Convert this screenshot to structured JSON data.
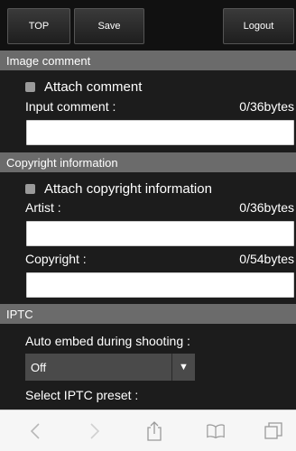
{
  "toolbar": {
    "top_label": "TOP",
    "save_label": "Save",
    "logout_label": "Logout"
  },
  "image_comment": {
    "header": "Image comment",
    "attach_label": "Attach comment",
    "input_label": "Input comment :",
    "byte_count": "0/36bytes",
    "input_value": ""
  },
  "copyright_info": {
    "header": "Copyright information",
    "attach_label": "Attach copyright information",
    "artist_label": "Artist :",
    "artist_bytes": "0/36bytes",
    "artist_value": "",
    "copyright_label": "Copyright :",
    "copyright_bytes": "0/54bytes",
    "copyright_value": ""
  },
  "iptc": {
    "header": "IPTC",
    "auto_embed_label": "Auto embed during shooting :",
    "auto_embed_value": "Off",
    "preset_label": "Select IPTC preset :"
  },
  "browser": {
    "icons": [
      "back-icon",
      "forward-icon",
      "share-icon",
      "bookmarks-icon",
      "tabs-icon"
    ]
  },
  "colors": {
    "background": "#1c1c1c",
    "section_header": "#6b6b6b",
    "select_bg": "#4a4a4a",
    "browser_bar": "#f6f6f6"
  }
}
